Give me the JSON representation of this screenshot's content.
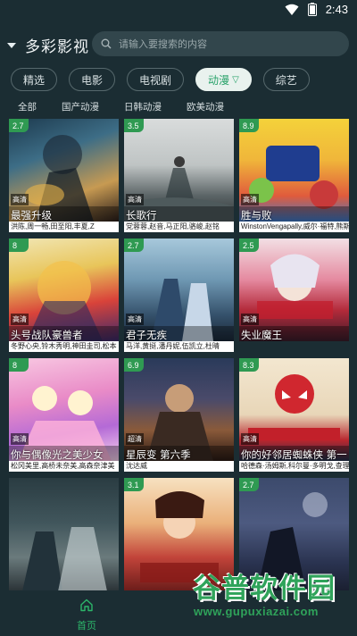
{
  "status": {
    "time": "2:43"
  },
  "header": {
    "app_title": "多彩影视",
    "search_placeholder": "请输入要搜索的内容"
  },
  "tabs": [
    {
      "label": "精选",
      "active": false
    },
    {
      "label": "电影",
      "active": false
    },
    {
      "label": "电视剧",
      "active": false
    },
    {
      "label": "动漫",
      "active": true
    },
    {
      "label": "综艺",
      "active": false
    }
  ],
  "subtabs": [
    "全部",
    "国产动漫",
    "日韩动漫",
    "欧美动漫"
  ],
  "cards": [
    {
      "score": "2.7",
      "quality": "高清",
      "title": "最强升级",
      "actors": "洪陈,周一畅,田至阳,丰夏,Z"
    },
    {
      "score": "3.5",
      "quality": "高清",
      "title": "长歌行",
      "actors": "党蓉蓉,赵音,马正阳,骆峻,赵铭"
    },
    {
      "score": "8.9",
      "quality": "高清",
      "title": "胜与败",
      "actors": "WinstonVengapally,威尔·福特,熊斯"
    },
    {
      "score": "8",
      "quality": "高清",
      "title": "头号战队豪兽者",
      "actors": "冬野心央,铃木秀明,神田圭司,松本"
    },
    {
      "score": "2.7",
      "quality": "高清",
      "title": "君子无疾",
      "actors": "马洋,黄挺,潘丹妮,伍凯立,杜晴"
    },
    {
      "score": "2.5",
      "quality": "高清",
      "title": "失业魔王",
      "actors": ""
    },
    {
      "score": "8",
      "quality": "高清",
      "title": "你与偶像光之美少女",
      "actors": "松冈美里,高桥未奈美,高森奈津美"
    },
    {
      "score": "6.9",
      "quality": "超清",
      "title": "星辰变 第六季",
      "actors": "沈达威"
    },
    {
      "score": "8.3",
      "quality": "高清",
      "title": "你的好邻居蜘蛛侠 第一",
      "actors": "哈德森·汤姆斯,科尔曼·多明戈,查理"
    },
    {
      "score": "",
      "quality": "",
      "title": "",
      "actors": ""
    },
    {
      "score": "3.1",
      "quality": "",
      "title": "",
      "actors": ""
    },
    {
      "score": "2.7",
      "quality": "",
      "title": "",
      "actors": ""
    }
  ],
  "bottom_nav": {
    "home_label": "首页"
  },
  "watermark": {
    "main": "谷普软件园",
    "url": "www.gupuxiazai.com"
  },
  "colors": {
    "accent": "#2aa36b",
    "background": "#1b2d33",
    "score_badge": "#2f9a52"
  }
}
